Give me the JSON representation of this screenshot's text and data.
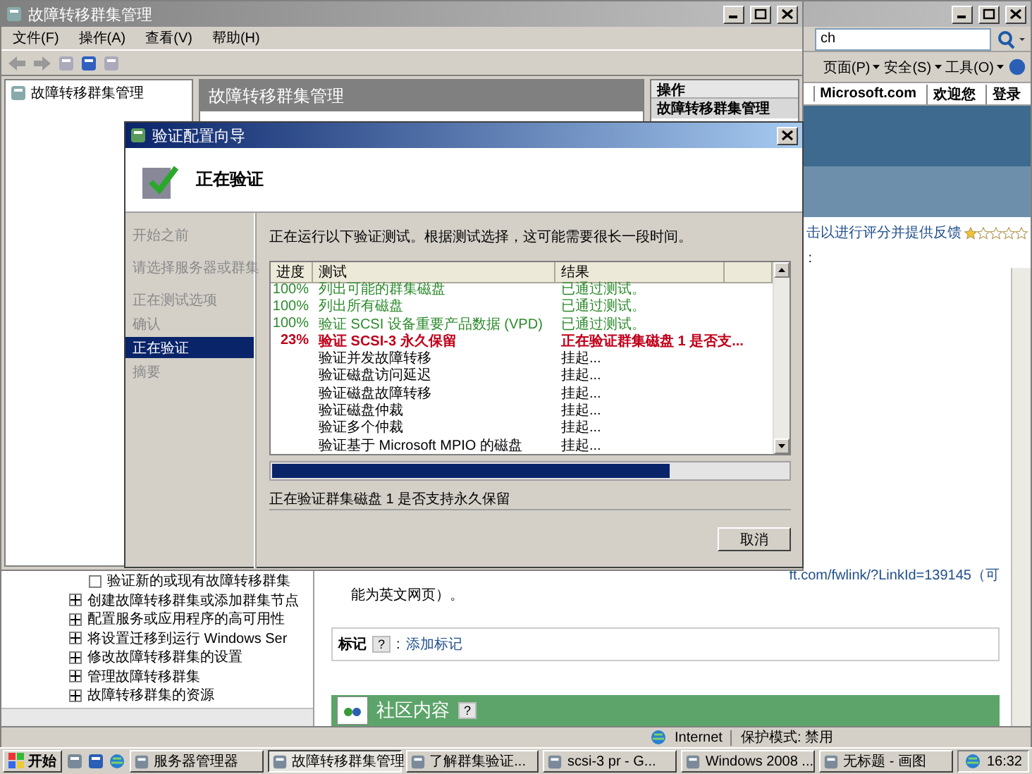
{
  "browser": {
    "search": {
      "value": "ch"
    },
    "toolbar": [
      {
        "label": "页面(P)"
      },
      {
        "label": "安全(S)"
      },
      {
        "label": "工具(O)"
      }
    ],
    "links": [
      "Microsoft.com",
      "欢迎您",
      "登录"
    ],
    "rating": {
      "text": "击以进行评分并提供反馈",
      "stars": 1
    },
    "rating_note": ":",
    "toc": [
      {
        "label": "验证新的或现有故障转移群集",
        "kind": "leaf"
      },
      {
        "label": "创建故障转移群集或添加群集节点",
        "kind": "collapsed"
      },
      {
        "label": "配置服务或应用程序的高可用性",
        "kind": "collapsed"
      },
      {
        "label": "将设置迁移到运行 Windows Ser",
        "kind": "collapsed"
      },
      {
        "label": "修改故障转移群集的设置",
        "kind": "collapsed"
      },
      {
        "label": "管理故障转移群集",
        "kind": "collapsed"
      },
      {
        "label": "故障转移群集的资源",
        "kind": "collapsed"
      }
    ],
    "content": {
      "link": "ft.com/fwlink/?LinkId=139145（可",
      "note": "能为英文网页）。",
      "tags_label": "标记",
      "tags_help": "?",
      "tags_sep": ":",
      "tags_link": "添加标记",
      "community": "社区内容",
      "community_help": "?"
    },
    "status": [
      "Internet",
      "保护模式: 禁用"
    ]
  },
  "mmc": {
    "title": "故障转移群集管理",
    "menus": [
      "文件(F)",
      "操作(A)",
      "查看(V)",
      "帮助(H)"
    ],
    "tree_root": "故障转移群集管理",
    "center_header": "故障转移群集管理",
    "actions_header": "操作",
    "actions_section": "故障转移群集管理"
  },
  "dialog": {
    "title": "验证配置向导",
    "heading": "正在验证",
    "steps": [
      {
        "label": "开始之前",
        "selected": false
      },
      {
        "label": "请选择服务器或群集",
        "selected": false
      },
      {
        "label": "正在测试选项",
        "selected": false
      },
      {
        "label": "确认",
        "selected": false
      },
      {
        "label": "正在验证",
        "selected": true
      },
      {
        "label": "摘要",
        "selected": false
      }
    ],
    "intro": "正在运行以下验证测试。根据测试选择，这可能需要很长一段时间。",
    "columns": [
      "进度",
      "测试",
      "结果"
    ],
    "rows": [
      {
        "progress": "100%",
        "test": "列出可能的群集磁盘",
        "result": "已通过测试。",
        "kind": "passed"
      },
      {
        "progress": "100%",
        "test": "列出所有磁盘",
        "result": "已通过测试。",
        "kind": "passed"
      },
      {
        "progress": "100%",
        "test": "验证 SCSI 设备重要产品数据 (VPD)",
        "result": "已通过测试。",
        "kind": "passed"
      },
      {
        "progress": "23%",
        "test": "验证 SCSI-3 永久保留",
        "result": "正在验证群集磁盘 1 是否支...",
        "kind": "running"
      },
      {
        "test": "验证并发故障转移",
        "result": "挂起...",
        "kind": "pending"
      },
      {
        "test": "验证磁盘访问延迟",
        "result": "挂起...",
        "kind": "pending"
      },
      {
        "test": "验证磁盘故障转移",
        "result": "挂起...",
        "kind": "pending"
      },
      {
        "test": "验证磁盘仲裁",
        "result": "挂起...",
        "kind": "pending"
      },
      {
        "test": "验证多个仲裁",
        "result": "挂起...",
        "kind": "pending"
      },
      {
        "test": "验证基于 Microsoft MPIO 的磁盘",
        "result": "挂起...",
        "kind": "pending"
      }
    ],
    "progress": {
      "level": 0.77
    },
    "status_text": "正在验证群集磁盘 1 是否支持永久保留",
    "cancel": "取消"
  },
  "taskbar": {
    "start": "开始",
    "tasks": [
      {
        "label": "服务器管理器",
        "selected": false
      },
      {
        "label": "故障转移群集管理",
        "selected": true
      },
      {
        "label": "了解群集验证...",
        "selected": false
      },
      {
        "label": "scsi-3 pr - G...",
        "selected": false
      },
      {
        "label": "Windows 2008 ...",
        "selected": false
      },
      {
        "label": "无标题 - 画图",
        "selected": false
      }
    ],
    "clock": "16:32"
  }
}
